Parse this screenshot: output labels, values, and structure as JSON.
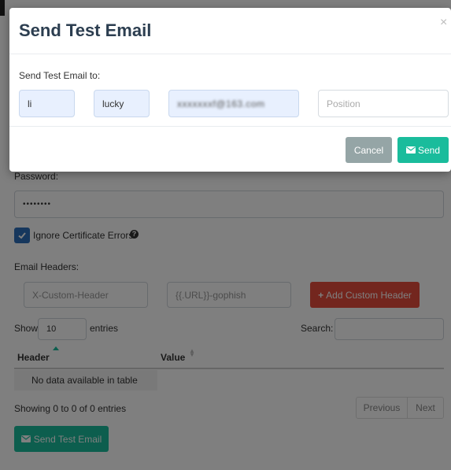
{
  "background_form": {
    "password_label": "Password:",
    "password_value": "••••••••",
    "ignore_cert_label": "Ignore Certificate Errors",
    "email_headers_label": "Email Headers:",
    "header_name_placeholder": "X-Custom-Header",
    "header_value_placeholder": "{{.URL}}-gophish",
    "add_header_button": "Add Custom Header",
    "show_label": "Show",
    "entries_count": "10",
    "entries_label": "entries",
    "search_label": "Search:",
    "table_headers": [
      "Header",
      "Value"
    ],
    "empty_message": "No data available in table",
    "showing_info": "Showing 0 to 0 of 0 entries",
    "previous_button": "Previous",
    "next_button": "Next",
    "send_test_email_button": "Send Test Email"
  },
  "modal": {
    "title": "Send Test Email",
    "close_symbol": "×",
    "send_to_label": "Send Test Email to:",
    "first_name": "li",
    "last_name": "lucky",
    "email": "xxxxxxxf@163.com",
    "position_placeholder": "Position",
    "cancel_button": "Cancel",
    "send_button": "Send"
  },
  "colors": {
    "primary_text": "#2c3e50",
    "success": "#1abc9c",
    "danger": "#e74c3c",
    "cancel": "#95a5a6",
    "input_highlight_bg": "#e8f0fe",
    "checkbox": "#2c6fbb"
  },
  "icons": {
    "help": "question-circle-icon",
    "envelope": "envelope-icon",
    "plus": "plus-icon",
    "sort": "sort-icon",
    "checkbox": "check-icon"
  }
}
